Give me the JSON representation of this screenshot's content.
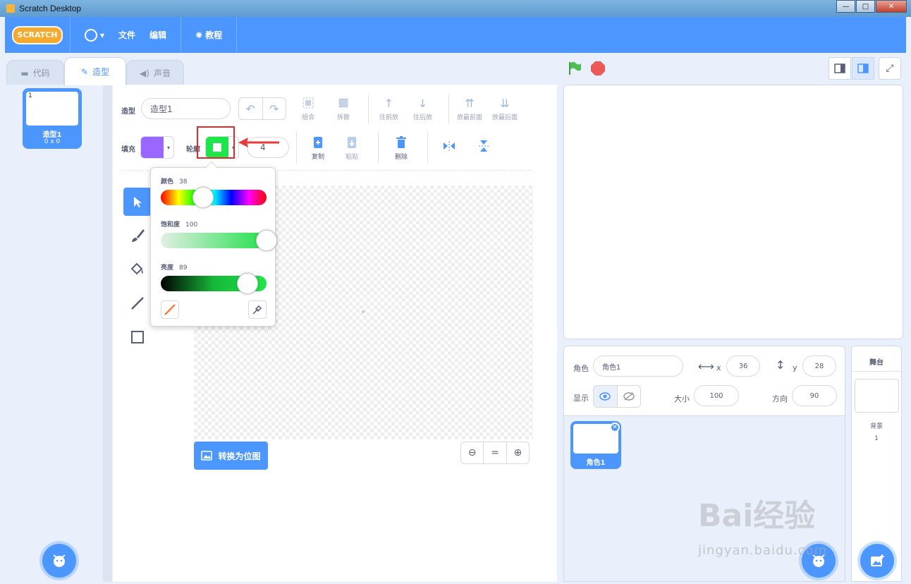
{
  "window": {
    "title": "Scratch Desktop",
    "buttons": [
      "—",
      "□",
      "✕"
    ]
  },
  "menubar": {
    "logo": "SCRATCH",
    "file": "文件",
    "edit": "编辑",
    "tutorials": "教程"
  },
  "tabs": [
    {
      "label": "代码"
    },
    {
      "label": "造型"
    },
    {
      "label": "声音"
    }
  ],
  "costume_list": {
    "item": {
      "number": "1",
      "name": "造型1",
      "size": "0 x 0"
    }
  },
  "editor": {
    "costume_label": "造型",
    "costume_name": "造型1",
    "group": "组合",
    "ungroup": "拆散",
    "forward": "往前放",
    "backward": "往后放",
    "front": "放最前面",
    "back": "放最后面",
    "fill_label": "填充",
    "fill_color": "#9966ff",
    "outline_label": "轮廓",
    "outline_color": "#1ee64a",
    "outline_width": "4",
    "copy": "复制",
    "paste": "粘贴",
    "delete": "删除",
    "convert_bitmap": "转换为位图",
    "zoom_equal": "="
  },
  "color_picker": {
    "hue_label": "颜色",
    "hue_value": "38",
    "saturation_label": "饱和度",
    "saturation_value": "100",
    "brightness_label": "亮度",
    "brightness_value": "89",
    "hue_level": 0.4,
    "saturation_level": 1.0,
    "brightness_level": 0.82
  },
  "sprite_info": {
    "sprite_label": "角色",
    "sprite_name": "角色1",
    "x_label": "x",
    "x_value": "36",
    "y_label": "y",
    "y_value": "28",
    "show_label": "显示",
    "size_label": "大小",
    "size_value": "100",
    "direction_label": "方向",
    "direction_value": "90"
  },
  "sprite_list": {
    "item_name": "角色1"
  },
  "stage_panel": {
    "title": "舞台",
    "backdrops_label": "背景",
    "backdrops_count": "1"
  },
  "watermark": {
    "main": "Bai经验",
    "sub": "jingyan.baidu.com"
  }
}
